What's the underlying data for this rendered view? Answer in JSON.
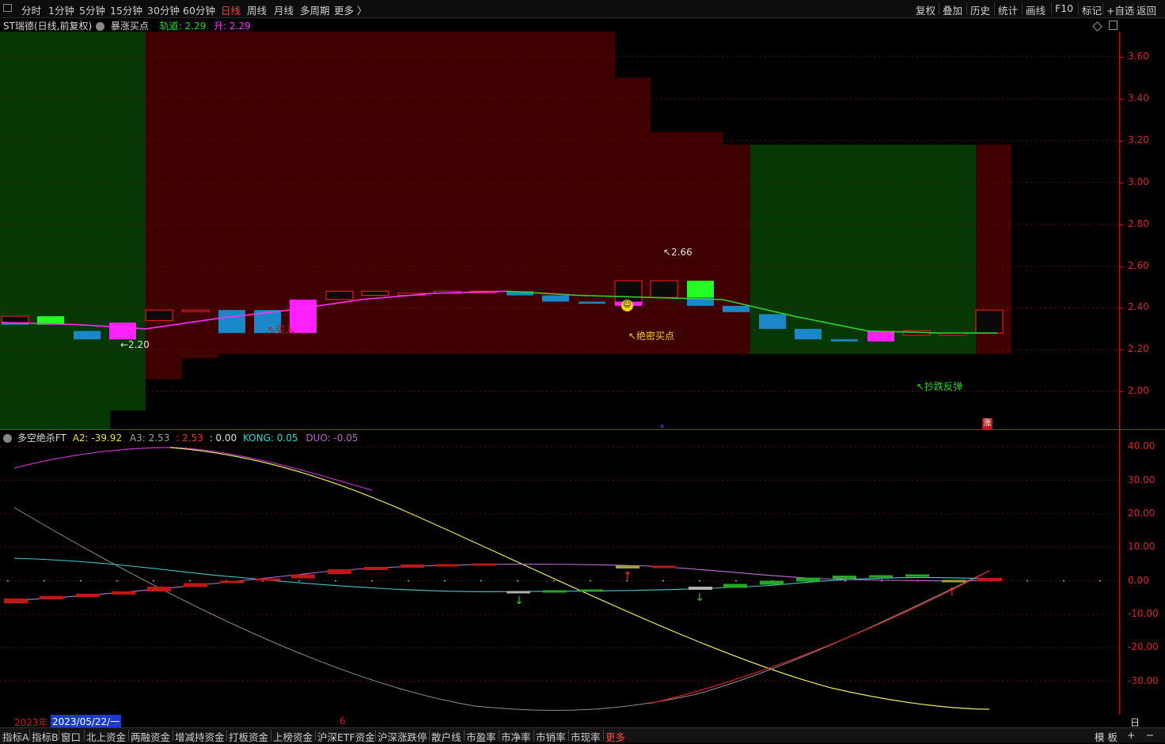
{
  "toolbar": {
    "periods": [
      "分时",
      "1分钟",
      "5分钟",
      "15分钟",
      "30分钟",
      "60分钟",
      "日线",
      "周线",
      "月线",
      "多周期",
      "更多 〉"
    ],
    "active_period": "日线",
    "right_buttons": [
      "复权",
      "叠加",
      "历史",
      "统计",
      "画线",
      "F10",
      "标记",
      "+自选",
      "返回"
    ]
  },
  "main_chart": {
    "title": "ST瑞德(日线,前复权)",
    "indicator_name": "暴涨买点",
    "track_label": "轨道: 2.29",
    "rise_label": "升: 2.29",
    "annotations": {
      "low_price": "←2.20",
      "high_price": "↖2.66",
      "buy_partial": "↖买入",
      "secret_buy": "↖绝密买点",
      "rebound": "↖抄跌反弹",
      "zhang_badge": "涨"
    },
    "price_axis": [
      "3.60",
      "3.40",
      "3.20",
      "3.00",
      "2.80",
      "2.60",
      "2.40",
      "2.20",
      "2.00"
    ]
  },
  "sub_chart": {
    "indicator_name": "多空绝杀FT",
    "a2_label": "A2: -39.92",
    "a3_label": "A3: 2.53",
    "a3_value": ": 2.53",
    "zero_label": ": 0.00",
    "kong_label": "KONG: 0.05",
    "duo_label": "DUO: -0.05",
    "value_axis": [
      "40.00",
      "30.00",
      "20.00",
      "10.00",
      "0.00",
      "-10.00",
      "-20.00",
      "-30.00"
    ]
  },
  "date_bar": {
    "year": "2023年",
    "date": "2023/05/22/一",
    "month_mark": "6",
    "period_label": "日线"
  },
  "bottom_tabs": [
    "指标A",
    "指标B",
    "窗口",
    "北上资金",
    "两融资金",
    "增减持资金",
    "打板资金",
    "上榜资金",
    "沪深ETF资金",
    "沪深涨跌停",
    "散户线",
    "市盈率",
    "市净率",
    "市销率",
    "市现率",
    "更多"
  ],
  "bottom_right": [
    "模 板",
    "+",
    "−"
  ],
  "chart_data": {
    "type": "candlestick",
    "price_range": [
      1.82,
      3.72
    ],
    "candles": [
      {
        "o": 2.33,
        "h": 2.36,
        "l": 2.33,
        "c": 2.36
      },
      {
        "o": 2.36,
        "h": 2.36,
        "l": 2.32,
        "c": 2.32
      },
      {
        "o": 2.29,
        "h": 2.29,
        "l": 2.25,
        "c": 2.25
      },
      {
        "o": 2.25,
        "h": 2.33,
        "l": 2.25,
        "c": 2.33
      },
      {
        "o": 2.34,
        "h": 2.39,
        "l": 2.34,
        "c": 2.39
      },
      {
        "o": 2.39,
        "h": 2.39,
        "l": 2.39,
        "c": 2.39
      },
      {
        "o": 2.39,
        "h": 2.39,
        "l": 2.28,
        "c": 2.28
      },
      {
        "o": 2.39,
        "h": 2.39,
        "l": 2.28,
        "c": 2.28
      },
      {
        "o": 2.28,
        "h": 2.44,
        "l": 2.28,
        "c": 2.44
      },
      {
        "o": 2.44,
        "h": 2.48,
        "l": 2.44,
        "c": 2.48
      },
      {
        "o": 2.46,
        "h": 2.48,
        "l": 2.46,
        "c": 2.48
      },
      {
        "o": 2.46,
        "h": 2.47,
        "l": 2.46,
        "c": 2.47
      },
      {
        "o": 2.47,
        "h": 2.48,
        "l": 2.47,
        "c": 2.48
      },
      {
        "o": 2.48,
        "h": 2.48,
        "l": 2.48,
        "c": 2.48
      },
      {
        "o": 2.48,
        "h": 2.48,
        "l": 2.46,
        "c": 2.46
      },
      {
        "o": 2.46,
        "h": 2.46,
        "l": 2.43,
        "c": 2.43
      },
      {
        "o": 2.43,
        "h": 2.43,
        "l": 2.42,
        "c": 2.42
      },
      {
        "o": 2.42,
        "h": 2.53,
        "l": 2.41,
        "c": 2.53
      },
      {
        "o": 2.45,
        "h": 2.53,
        "l": 2.45,
        "c": 2.53
      },
      {
        "o": 2.53,
        "h": 2.53,
        "l": 2.45,
        "c": 2.45
      },
      {
        "o": 2.41,
        "h": 2.41,
        "l": 2.38,
        "c": 2.38
      },
      {
        "o": 2.37,
        "h": 2.37,
        "l": 2.3,
        "c": 2.3
      },
      {
        "o": 2.3,
        "h": 2.3,
        "l": 2.25,
        "c": 2.25
      },
      {
        "o": 2.25,
        "h": 2.25,
        "l": 2.24,
        "c": 2.24
      },
      {
        "o": 2.24,
        "h": 2.29,
        "l": 2.24,
        "c": 2.29
      },
      {
        "o": 2.27,
        "h": 2.29,
        "l": 2.27,
        "c": 2.29
      },
      {
        "o": 2.27,
        "h": 2.28,
        "l": 2.27,
        "c": 2.28
      },
      {
        "o": 2.28,
        "h": 2.39,
        "l": 2.28,
        "c": 2.39
      }
    ]
  }
}
